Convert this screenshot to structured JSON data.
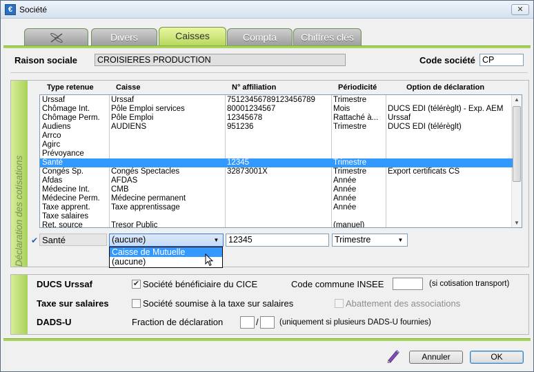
{
  "window": {
    "title": "Société",
    "close_glyph": "✕",
    "app_icon": "€"
  },
  "tabs": [
    {
      "label": "",
      "icon": "dragonfly-icon"
    },
    {
      "label": "Divers"
    },
    {
      "label": "Caisses",
      "active": true
    },
    {
      "label": "Compta"
    },
    {
      "label": "Chiffres clés"
    }
  ],
  "header": {
    "raison_label": "Raison sociale",
    "raison_value": "CROISIERES PRODUCTION",
    "code_label": "Code société",
    "code_value": "CP"
  },
  "cotisations": {
    "section_title": "Déclaration des cotisations",
    "columns": [
      "Type retenue",
      "Caisse",
      "N° affiliation",
      "Périodicité",
      "Option de déclaration"
    ],
    "rows": [
      [
        "Urssaf",
        "Urssaf",
        "75123456789123456789",
        "Trimestre",
        ""
      ],
      [
        "Chômage Int.",
        "Pôle Emploi services",
        "80001234567",
        "Mois",
        "DUCS EDI (télérèglt) - Exp. AEM"
      ],
      [
        "Chômage Perm.",
        "Pôle Emploi",
        "12345678",
        "Rattaché à...",
        "Urssaf"
      ],
      [
        "Audiens",
        "AUDIENS",
        "951236",
        "Trimestre",
        "DUCS EDI (télérèglt)"
      ],
      [
        "Arrco",
        "",
        "",
        "",
        ""
      ],
      [
        "Agirc",
        "",
        "",
        "",
        ""
      ],
      [
        "Prévoyance",
        "",
        "",
        "",
        ""
      ],
      [
        "Santé",
        "",
        "12345",
        "Trimestre",
        ""
      ],
      [
        "Congés Sp.",
        "Congés Spectacles",
        "32873001X",
        "Trimestre",
        "Export certificats CS"
      ],
      [
        "Afdas",
        "AFDAS",
        "",
        "Année",
        ""
      ],
      [
        "Médecine Int.",
        "CMB",
        "",
        "Année",
        ""
      ],
      [
        "Médecine Perm.",
        "Médecine permanent",
        "",
        "Année",
        ""
      ],
      [
        "Taxe apprent.",
        "Taxe apprentissage",
        "",
        "Année",
        ""
      ],
      [
        "Taxe salaires",
        "",
        "",
        "",
        ""
      ],
      [
        "Ret. source",
        "Tresor Public",
        "",
        "(manuel)",
        ""
      ]
    ],
    "selected_row": 7,
    "editor": {
      "check_glyph": "✔",
      "type": "Santé",
      "caisse_value": "(aucune)",
      "affiliation_value": "12345",
      "periodicite_value": "Trimestre",
      "dropdown_options": [
        "Caisse de Mutuelle",
        "(aucune)"
      ],
      "highlighted_option": 0
    }
  },
  "declarations": {
    "ducs_label": "DUCS Urssaf",
    "cice_label": "Société bénéficiaire du CICE",
    "cice_checked": true,
    "insee_label": "Code commune INSEE",
    "insee_value": "",
    "insee_note": "(si cotisation transport)",
    "taxe_label": "Taxe sur salaires",
    "taxe_cb_label": "Société soumise à la taxe sur salaires",
    "taxe_checked": false,
    "abattement_label": "Abattement des associations",
    "abattement_checked": false,
    "dadsu_label": "DADS-U",
    "fraction_label": "Fraction de déclaration",
    "fraction_sep": "/",
    "fraction_note": "(uniquement si plusieurs DADS-U fournies)"
  },
  "footer": {
    "cancel_label": "Annuler",
    "ok_label": "OK"
  }
}
